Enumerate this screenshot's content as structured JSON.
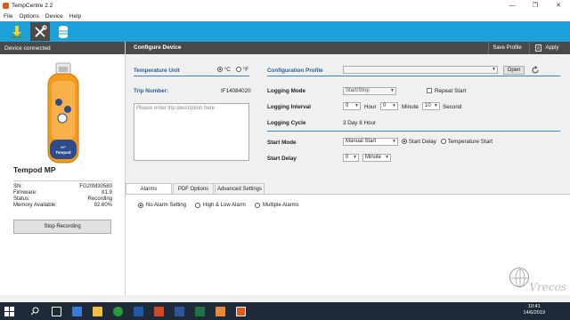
{
  "window": {
    "title": "TempCentre 2.2"
  },
  "menu": [
    "File",
    "Options",
    "Device",
    "Help"
  ],
  "left": {
    "header": "Device connected",
    "device_name": "Tempod MP",
    "props": [
      {
        "label": "SN:",
        "value": "FG20M30580"
      },
      {
        "label": "Firmware:",
        "value": "X1.9"
      },
      {
        "label": "Status:",
        "value": "Recording"
      },
      {
        "label": "Memory Available:",
        "value": "92.60%"
      }
    ],
    "stop_button": "Stop Recording"
  },
  "header": {
    "title": "Configure Device",
    "save_profile": "Save Profile",
    "apply": "Apply"
  },
  "temp_unit": {
    "label": "Temperature Unit",
    "c": "°C",
    "f": "°F",
    "selected": "c"
  },
  "trip": {
    "label": "Trip Number:",
    "value": "IF14084020",
    "placeholder": "Please enter trip description here"
  },
  "config": {
    "profile_label": "Configuration Profile",
    "open_button": "Open",
    "logging_mode_label": "Logging Mode",
    "logging_mode_value": "Start/Stop",
    "repeat_start": "Repeat Start",
    "logging_interval_label": "Logging Interval",
    "hour_value": "0",
    "hour_unit": "Hour",
    "minute_value": "0",
    "minute_unit": "Minute",
    "second_value": "10",
    "second_unit": "Second",
    "logging_cycle_label": "Logging Cycle",
    "logging_cycle_value": "3 Day 8 Hour",
    "start_mode_label": "Start Mode",
    "start_mode_value": "Manual Start",
    "start_delay_radio": "Start Delay",
    "temperature_start_radio": "Temperature Start",
    "start_delay_label": "Start Delay",
    "start_delay_value": "0",
    "start_delay_unit": "Minute"
  },
  "tabs": [
    "Alarms",
    "PDF Options",
    "Advanced Settings"
  ],
  "alarms": {
    "options": [
      "No Alarm Setting",
      "High & Low Alarm",
      "Multiple Alarms"
    ],
    "selected": 0
  },
  "taskbar": {
    "time": "10:41",
    "date": "14/6/2019"
  },
  "watermark": "Vrecos",
  "colors": {
    "toolbar": "#1ea0d8",
    "header": "#4a4a4a",
    "label_blue": "#2b5d9a",
    "device_orange": "#f39a1e"
  }
}
